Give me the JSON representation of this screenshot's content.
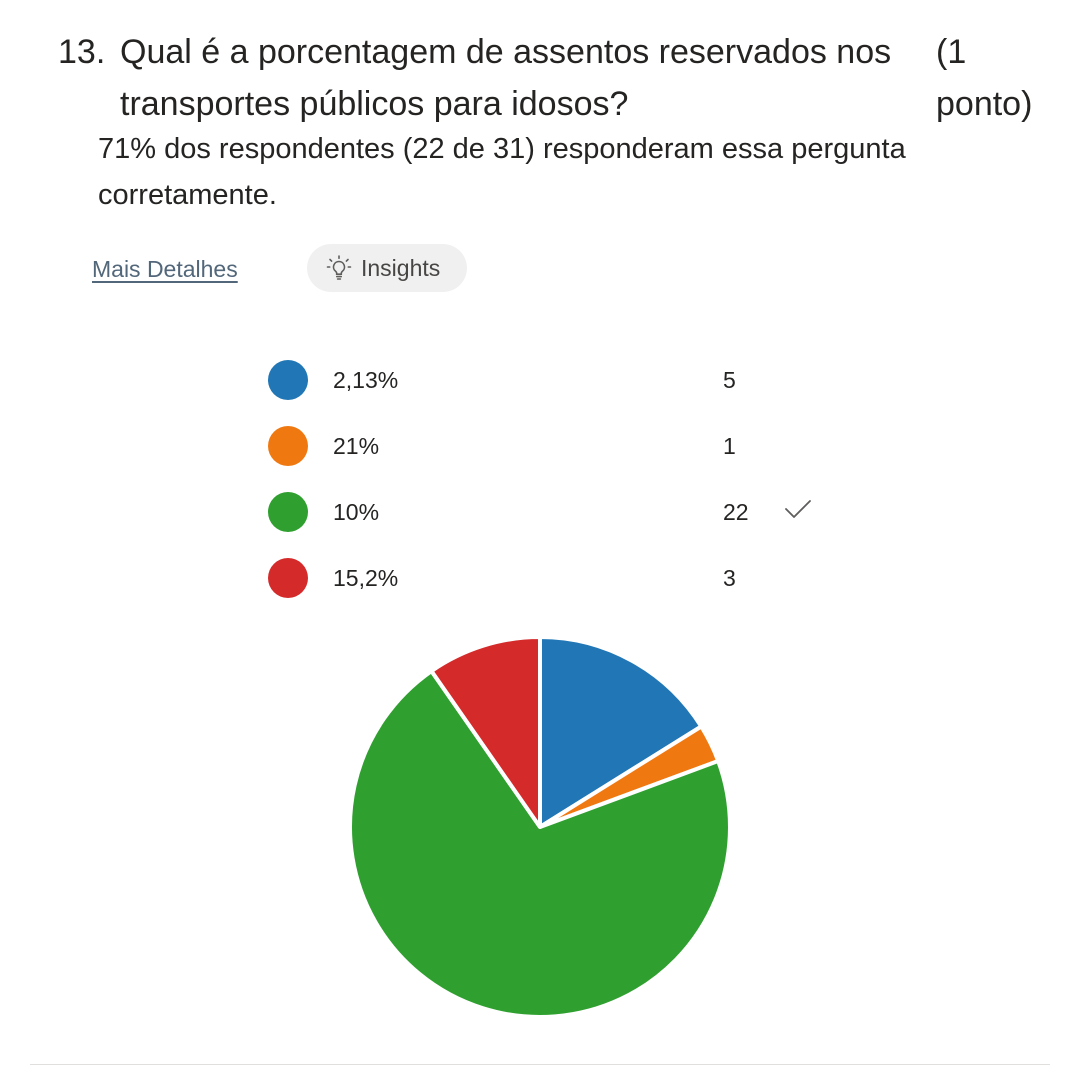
{
  "question": {
    "number": "13.",
    "text": "Qual é a porcentagem de assentos reservados nos transportes públicos para idosos?",
    "points": "(1 ponto)"
  },
  "summary": "71% dos respondentes (22 de 31) responderam essa pergunta corretamente.",
  "links": {
    "more_details": "Mais Detalhes",
    "insights": "Insights"
  },
  "icons": {
    "insights": "lightbulb-icon",
    "correct": "checkmark-icon"
  },
  "chart_data": {
    "type": "pie",
    "categories": [
      "2,13%",
      "21%",
      "10%",
      "15,2%"
    ],
    "values": [
      5,
      1,
      22,
      3
    ],
    "counts": [
      "5",
      "1",
      "22",
      "3"
    ],
    "colors": [
      "#2177b5",
      "#f07810",
      "#2fa02f",
      "#d42a2a"
    ],
    "correct_index": 2,
    "title": ""
  }
}
